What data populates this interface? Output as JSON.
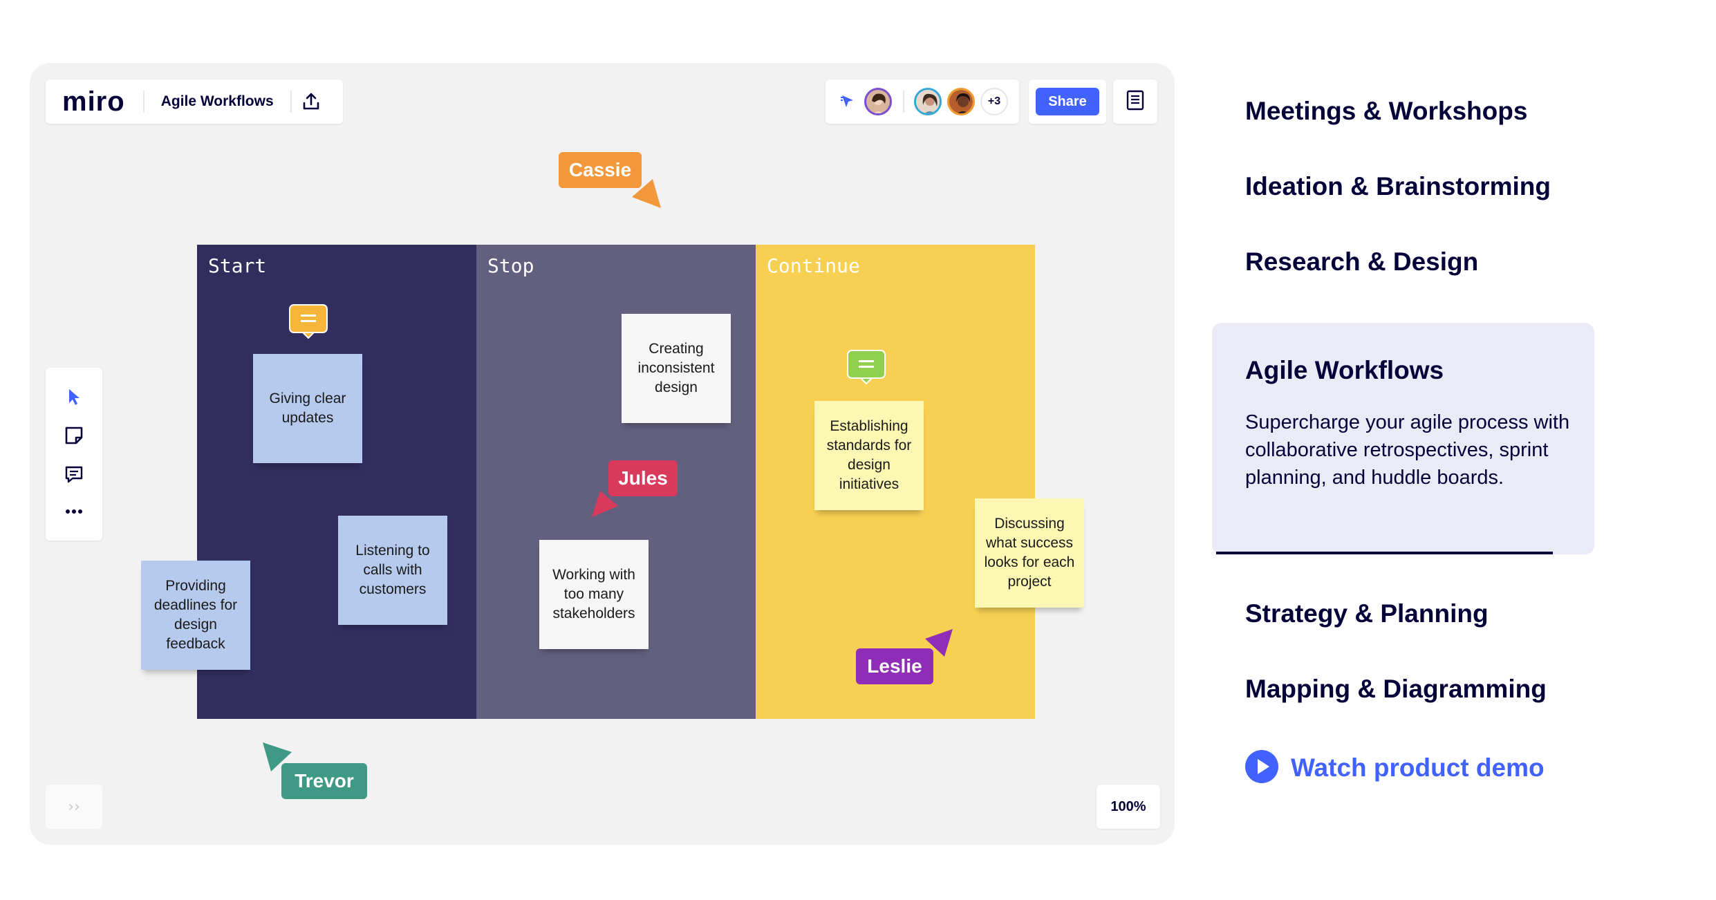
{
  "app": {
    "logo": "miro",
    "board_name": "Agile Workflows",
    "share_label": "Share",
    "extra_collaborators": "+3",
    "zoom": "100%",
    "expand_glyph": "››"
  },
  "columns": [
    {
      "title": "Start",
      "color": "#312e5e"
    },
    {
      "title": "Stop",
      "color": "#62607e"
    },
    {
      "title": "Continue",
      "color": "#f7d053"
    }
  ],
  "stickies": [
    {
      "text": "Giving clear updates",
      "color": "#b6caee"
    },
    {
      "text": "Listening to calls with customers",
      "color": "#b6caee"
    },
    {
      "text": "Providing deadlines for design feedback",
      "color": "#b6caee"
    },
    {
      "text": "Creating inconsistent design",
      "color": "#f6f6f6"
    },
    {
      "text": "Working with too many stakeholders",
      "color": "#f6f6f6"
    },
    {
      "text": "Establishing standards for design initiatives",
      "color": "#fcf7b2"
    },
    {
      "text": "Discussing what success looks for each project",
      "color": "#fcf7b2"
    }
  ],
  "cursors": [
    {
      "name": "Cassie",
      "color": "#f1983d"
    },
    {
      "name": "Jules",
      "color": "#d93a5b"
    },
    {
      "name": "Leslie",
      "color": "#8f2db7"
    },
    {
      "name": "Trevor",
      "color": "#3f9a85"
    }
  ],
  "menu": {
    "items": [
      "Meetings & Workshops",
      "Ideation & Brainstorming",
      "Research & Design",
      "Strategy & Planning",
      "Mapping & Diagramming"
    ],
    "active": {
      "title": "Agile Workflows",
      "description": "Supercharge your agile process with collaborative retrospectives, sprint planning, and huddle boards."
    },
    "demo_link": "Watch product demo"
  },
  "icons": {
    "upload": "upload-icon",
    "select": "cursor-select-icon",
    "sticky": "sticky-note-icon",
    "comment": "comment-icon",
    "more": "more-icon",
    "notes": "notes-icon",
    "follow": "follow-cursor-icon",
    "play": "play-icon"
  },
  "accent": "#4262ff"
}
